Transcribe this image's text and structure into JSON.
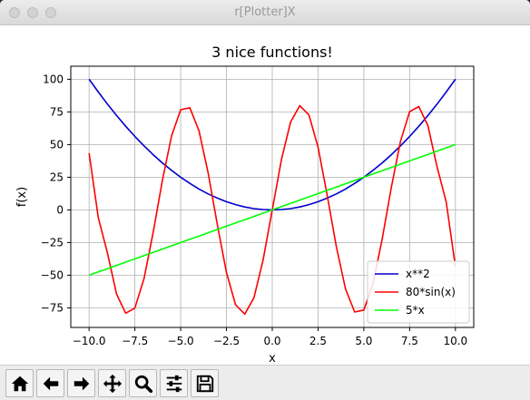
{
  "window": {
    "title": "r[Plotter]X"
  },
  "toolbar": {
    "buttons": [
      {
        "icon": "home-icon"
      },
      {
        "icon": "back-arrow-icon"
      },
      {
        "icon": "forward-arrow-icon"
      },
      {
        "icon": "pan-icon"
      },
      {
        "icon": "zoom-icon"
      },
      {
        "icon": "configure-subplots-icon"
      },
      {
        "icon": "save-icon"
      }
    ]
  },
  "chart_data": {
    "type": "line",
    "title": "3 nice functions!",
    "xlabel": "x",
    "ylabel": "f(x)",
    "xlim": [
      -11,
      11
    ],
    "ylim": [
      -90,
      110
    ],
    "xticks": [
      -10.0,
      -7.5,
      -5.0,
      -2.5,
      0.0,
      2.5,
      5.0,
      7.5,
      10.0
    ],
    "xtick_labels": [
      "−10.0",
      "−7.5",
      "−5.0",
      "−2.5",
      "0.0",
      "2.5",
      "5.0",
      "7.5",
      "10.0"
    ],
    "yticks": [
      -75,
      -50,
      -25,
      0,
      25,
      50,
      75,
      100
    ],
    "ytick_labels": [
      "−75",
      "−50",
      "−25",
      "0",
      "25",
      "50",
      "75",
      "100"
    ],
    "grid": true,
    "legend_position": "lower-right",
    "x": [
      -10,
      -9.5,
      -9,
      -8.5,
      -8,
      -7.5,
      -7,
      -6.5,
      -6,
      -5.5,
      -5,
      -4.5,
      -4,
      -3.5,
      -3,
      -2.5,
      -2,
      -1.5,
      -1,
      -0.5,
      0,
      0.5,
      1,
      1.5,
      2,
      2.5,
      3,
      3.5,
      4,
      4.5,
      5,
      5.5,
      6,
      6.5,
      7,
      7.5,
      8,
      8.5,
      9,
      9.5,
      10
    ],
    "series": [
      {
        "name": "x**2",
        "color": "#0000cc",
        "values": [
          100,
          90.25,
          81,
          72.25,
          64,
          56.25,
          49,
          42.25,
          36,
          30.25,
          25,
          20.25,
          16,
          12.25,
          9,
          6.25,
          4,
          2.25,
          1,
          0.25,
          0,
          0.25,
          1,
          2.25,
          4,
          6.25,
          9,
          12.25,
          16,
          20.25,
          25,
          30.25,
          36,
          42.25,
          49,
          56.25,
          64,
          72.25,
          81,
          90.25,
          100
        ]
      },
      {
        "name": "80*sin(x)",
        "color": "#ff0000",
        "values": [
          43.5,
          -6,
          -33,
          -64.6,
          -79.1,
          -75.2,
          -52.6,
          -17.2,
          22.4,
          56.5,
          76.7,
          78.2,
          60.5,
          28.1,
          -11.3,
          -47.9,
          -72.7,
          -79.8,
          -67.3,
          -38.4,
          0,
          38.4,
          67.3,
          79.8,
          72.7,
          47.9,
          11.3,
          -28.1,
          -60.5,
          -78.2,
          -76.7,
          -56.5,
          -22.4,
          17.2,
          52.6,
          75.2,
          79.1,
          64.6,
          33,
          6,
          -43.5
        ]
      },
      {
        "name": "5*x",
        "color": "#00ff00",
        "values": [
          -50,
          -47.5,
          -45,
          -42.5,
          -40,
          -37.5,
          -35,
          -32.5,
          -30,
          -27.5,
          -25,
          -22.5,
          -20,
          -17.5,
          -15,
          -12.5,
          -10,
          -7.5,
          -5,
          -2.5,
          0,
          2.5,
          5,
          7.5,
          10,
          12.5,
          15,
          17.5,
          20,
          22.5,
          25,
          27.5,
          30,
          32.5,
          35,
          37.5,
          40,
          42.5,
          45,
          47.5,
          50
        ]
      }
    ]
  }
}
